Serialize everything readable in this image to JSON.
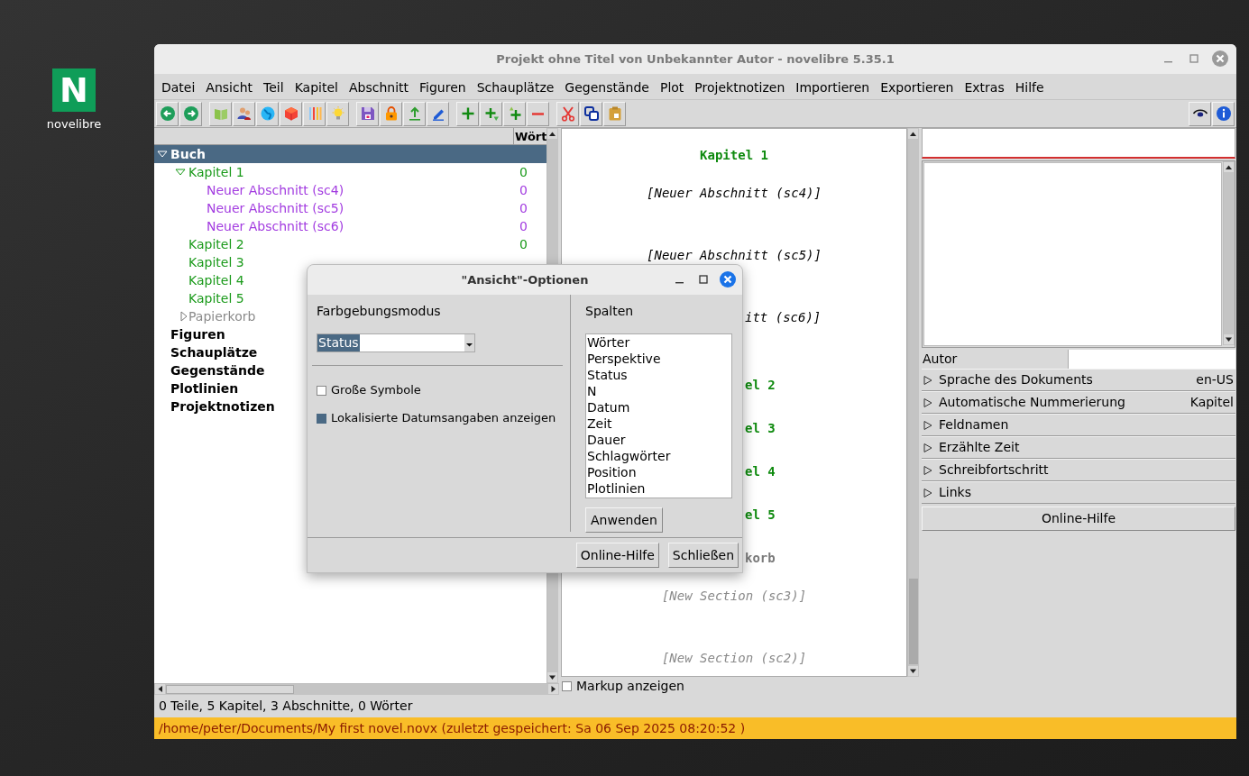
{
  "desktop_icon": {
    "glyph": "N",
    "label": "novelibre"
  },
  "window": {
    "title": "Projekt ohne Titel von Unbekannter Autor - novelibre 5.35.1"
  },
  "menu": [
    "Datei",
    "Ansicht",
    "Teil",
    "Kapitel",
    "Abschnitt",
    "Figuren",
    "Schauplätze",
    "Gegenstände",
    "Plot",
    "Projektnotizen",
    "Importieren",
    "Exportieren",
    "Extras",
    "Hilfe"
  ],
  "tree": {
    "column": "Wört",
    "items": [
      {
        "label": "Buch",
        "selected": true,
        "expanded": true,
        "children": [
          {
            "label": "Kapitel 1",
            "kind": "chapter",
            "selected": false,
            "expanded": true,
            "count": "0",
            "children": [
              {
                "label": "Neuer Abschnitt (sc4)",
                "kind": "section",
                "selected": false,
                "count": "0"
              },
              {
                "label": "Neuer Abschnitt (sc5)",
                "kind": "section",
                "selected": false,
                "count": "0"
              },
              {
                "label": "Neuer Abschnitt (sc6)",
                "kind": "section",
                "selected": false,
                "count": "0"
              }
            ]
          },
          {
            "label": "Kapitel 2",
            "kind": "chapter",
            "selected": false,
            "count": "0"
          },
          {
            "label": "Kapitel 3",
            "kind": "chapter",
            "selected": false
          },
          {
            "label": "Kapitel 4",
            "kind": "chapter",
            "selected": false
          },
          {
            "label": "Kapitel 5",
            "kind": "chapter",
            "selected": false
          },
          {
            "label": "Papierkorb",
            "kind": "trash",
            "selected": false,
            "expanded": false
          }
        ]
      },
      {
        "label": "Figuren",
        "selected": false
      },
      {
        "label": "Schauplätze",
        "selected": false
      },
      {
        "label": "Gegenstände",
        "selected": false
      },
      {
        "label": "Plotlinien",
        "selected": false
      },
      {
        "label": "Projektnotizen",
        "selected": false
      }
    ]
  },
  "text_view": {
    "lines": [
      {
        "text": "Kapitel 1",
        "kind": "chapter",
        "cut": false
      },
      {
        "text": "[Neuer Abschnitt (sc4)]",
        "kind": "section",
        "cut": false
      },
      {
        "text": "[Neuer Abschnitt (sc5)]",
        "kind": "section",
        "cut": false
      },
      {
        "text": "itt (sc6)]",
        "kind": "section",
        "cut": true
      },
      {
        "text": "el 2",
        "kind": "chapter",
        "cut": true
      },
      {
        "text": "el 3",
        "kind": "chapter",
        "cut": true
      },
      {
        "text": "el 4",
        "kind": "chapter",
        "cut": true
      },
      {
        "text": "el 5",
        "kind": "chapter",
        "cut": true
      },
      {
        "text": "korb",
        "kind": "trash",
        "cut": true
      },
      {
        "text": "[New Section (sc3)]",
        "kind": "unused",
        "cut": false
      },
      {
        "text": "[New Section (sc2)]",
        "kind": "unused",
        "cut": false
      }
    ]
  },
  "markup": {
    "label": "Markup anzeigen",
    "checked": false
  },
  "properties": {
    "author_label": "Autor",
    "sections": [
      {
        "label": "Sprache des Dokuments",
        "value": "en-US"
      },
      {
        "label": "Automatische Nummerierung",
        "value": "Kapitel"
      },
      {
        "label": "Feldnamen"
      },
      {
        "label": "Erzählte Zeit"
      },
      {
        "label": "Schreibfortschritt"
      },
      {
        "label": "Links"
      }
    ],
    "help_button": "Online-Hilfe"
  },
  "status": "0 Teile, 5 Kapitel, 3 Abschnitte, 0 Wörter",
  "path_bar": "/home/peter/Documents/My first novel.novx (zuletzt gespeichert: Sa 06 Sep 2025 08:20:52 )",
  "dialog": {
    "title": "\"Ansicht\"-Optionen",
    "coloring_label": "Farbgebungsmodus",
    "coloring_value": "Status",
    "options": [
      {
        "label": "Große Symbole",
        "checked": false
      },
      {
        "label": "Lokalisierte Datumsangaben anzeigen",
        "checked": true
      }
    ],
    "columns_label": "Spalten",
    "columns": [
      "Wörter",
      "Perspektive",
      "Status",
      "N",
      "Datum",
      "Zeit",
      "Dauer",
      "Schlagwörter",
      "Position",
      "Plotlinien"
    ],
    "apply_button": "Anwenden",
    "buttons": [
      "Online-Hilfe",
      "Schließen"
    ]
  }
}
